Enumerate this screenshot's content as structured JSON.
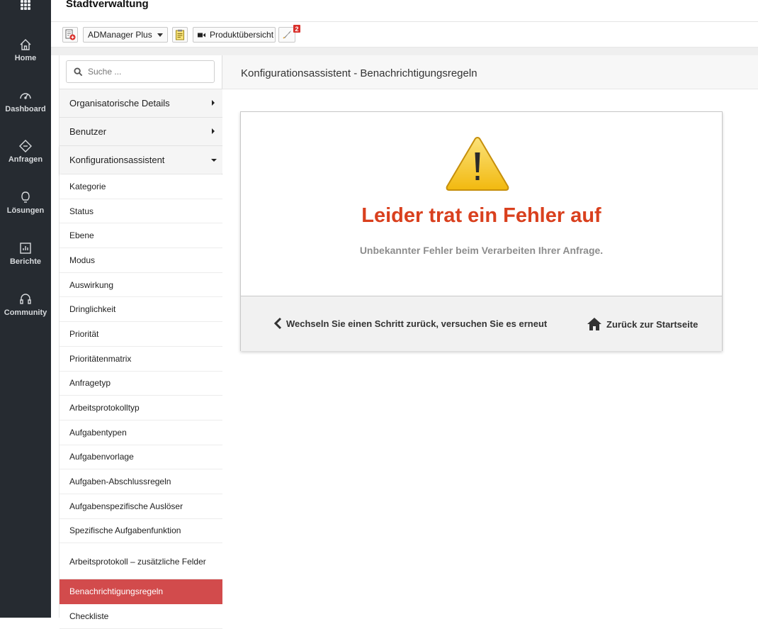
{
  "header": {
    "org_name": "Stadtverwaltung"
  },
  "rail": {
    "items": [
      {
        "label": "Home",
        "icon": "home-icon"
      },
      {
        "label": "Dashboard",
        "icon": "dashboard-icon"
      },
      {
        "label": "Anfragen",
        "icon": "ticket-icon"
      },
      {
        "label": "Lösungen",
        "icon": "lightbulb-icon"
      },
      {
        "label": "Berichte",
        "icon": "report-icon"
      },
      {
        "label": "Community",
        "icon": "headset-icon"
      }
    ]
  },
  "toolbar": {
    "app_select": "ADManager Plus",
    "product_overview": "Produktübersicht",
    "notification_count": "2"
  },
  "sidebar": {
    "search_placeholder": "Suche ...",
    "sections": [
      {
        "label": "Organisatorische Details",
        "state": "collapsed"
      },
      {
        "label": "Benutzer",
        "state": "collapsed"
      },
      {
        "label": "Konfigurationsassistent",
        "state": "expanded"
      }
    ],
    "items": [
      {
        "label": "Kategorie"
      },
      {
        "label": "Status"
      },
      {
        "label": "Ebene"
      },
      {
        "label": "Modus"
      },
      {
        "label": "Auswirkung"
      },
      {
        "label": "Dringlichkeit"
      },
      {
        "label": "Priorität"
      },
      {
        "label": "Prioritätenmatrix"
      },
      {
        "label": "Anfragetyp"
      },
      {
        "label": "Arbeitsprotokolltyp"
      },
      {
        "label": "Aufgabentypen"
      },
      {
        "label": "Aufgabenvorlage"
      },
      {
        "label": "Aufgaben-Abschlussregeln"
      },
      {
        "label": "Aufgabenspezifische Auslöser"
      },
      {
        "label": "Spezifische Aufgabenfunktion"
      },
      {
        "label": "Arbeitsprotokoll – zusätzliche Felder"
      },
      {
        "label": "Benachrichtigungsregeln"
      },
      {
        "label": "Checkliste"
      }
    ],
    "active_item": "Benachrichtigungsregeln"
  },
  "content": {
    "title": "Konfigurationsassistent - Benachrichtigungsregeln",
    "error": {
      "title": "Leider trat ein Fehler auf",
      "message": "Unbekannter Fehler beim Verarbeiten Ihrer Anfrage.",
      "back_link": "Wechseln Sie einen Schritt zurück, versuchen Sie es erneut",
      "home_link": "Zurück zur Startseite"
    }
  },
  "colors": {
    "rail_bg": "#262b31",
    "active_item": "#d24b4c",
    "error_title": "#d9401e",
    "warning_fill": "#f5c518"
  }
}
